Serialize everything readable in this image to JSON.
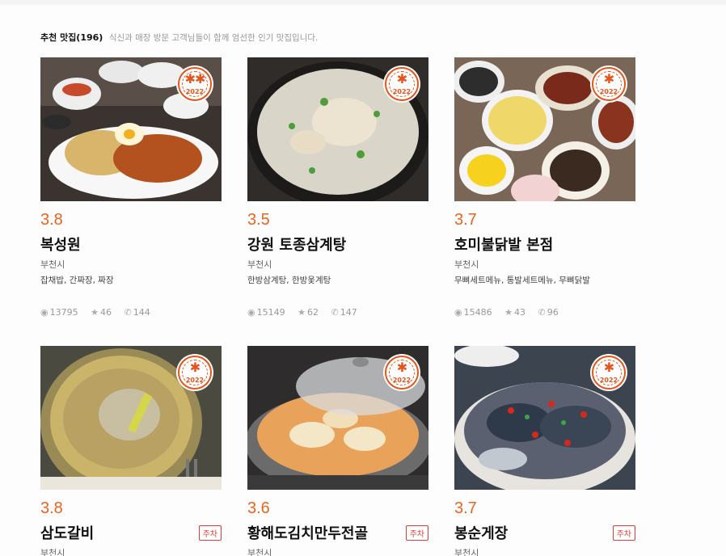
{
  "header": {
    "title": "추천 맛집(196)",
    "description": "식신과 매장 방문 고객님들이 함께 엄선한 인기 맛집입니다."
  },
  "colors": {
    "accent": "#e8641e",
    "badge": "#e3551c",
    "parking": "#e03b3b"
  },
  "restaurants": [
    {
      "rating": "3.8",
      "name": "복성원",
      "city": "부천시",
      "menu": "잡채밥, 간짜장, 짜장",
      "views": "13795",
      "stars": "46",
      "calls": "144",
      "badge_mark": "✱✱",
      "badge_year": "2022",
      "parking": ""
    },
    {
      "rating": "3.5",
      "name": "강원 토종삼계탕",
      "city": "부천시",
      "menu": "한방삼계탕, 한방옻계탕",
      "views": "15149",
      "stars": "62",
      "calls": "147",
      "badge_mark": "✱",
      "badge_year": "2022",
      "parking": ""
    },
    {
      "rating": "3.7",
      "name": "호미불닭발 본점",
      "city": "부천시",
      "menu": "무뼈세트메뉴, 통발세트메뉴, 무뼈닭발",
      "views": "15486",
      "stars": "43",
      "calls": "96",
      "badge_mark": "✱",
      "badge_year": "2022",
      "parking": ""
    },
    {
      "rating": "3.8",
      "name": "삼도갈비",
      "city": "부천시",
      "menu": "",
      "views": "",
      "stars": "",
      "calls": "",
      "badge_mark": "✱",
      "badge_year": "2022",
      "parking": "주차"
    },
    {
      "rating": "3.6",
      "name": "황해도김치만두전골",
      "city": "부천시",
      "menu": "",
      "views": "",
      "stars": "",
      "calls": "",
      "badge_mark": "✱",
      "badge_year": "2022",
      "parking": "주차"
    },
    {
      "rating": "3.7",
      "name": "봉순게장",
      "city": "부천시",
      "menu": "",
      "views": "",
      "stars": "",
      "calls": "",
      "badge_mark": "✱",
      "badge_year": "2022",
      "parking": "주차"
    }
  ],
  "icons": {
    "views": "eye-icon",
    "stars": "star-icon",
    "calls": "phone-icon"
  }
}
